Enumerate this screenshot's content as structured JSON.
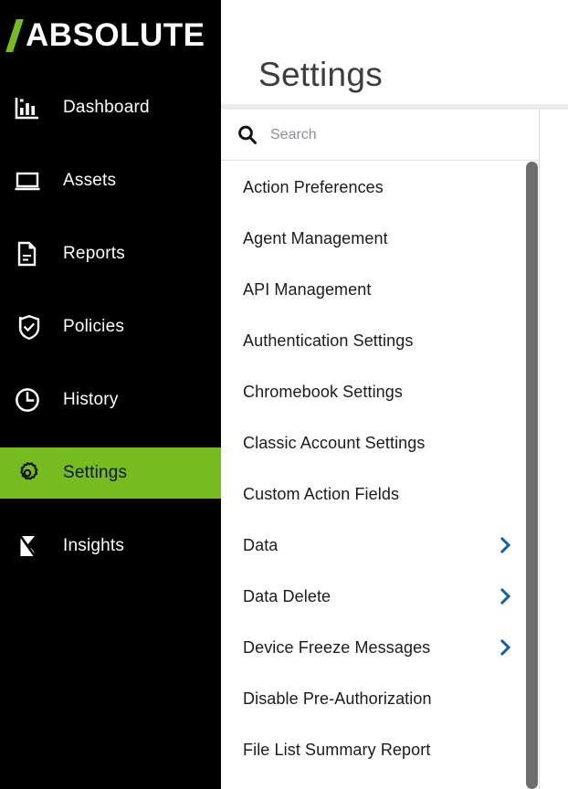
{
  "brand": {
    "name": "ABSOLUTE",
    "accent_color": "#76bc21",
    "logo_icon": "slash-mark"
  },
  "sidebar": {
    "background_color": "#000000",
    "active_color": "#76bc21",
    "items": [
      {
        "label": "Dashboard",
        "icon": "bar-chart-icon",
        "active": false
      },
      {
        "label": "Assets",
        "icon": "laptop-icon",
        "active": false
      },
      {
        "label": "Reports",
        "icon": "document-icon",
        "active": false
      },
      {
        "label": "Policies",
        "icon": "shield-check-icon",
        "active": false
      },
      {
        "label": "History",
        "icon": "clock-icon",
        "active": false
      },
      {
        "label": "Settings",
        "icon": "gear-icon",
        "active": true
      },
      {
        "label": "Insights",
        "icon": "insights-k-icon",
        "active": false
      }
    ]
  },
  "header": {
    "title": "Settings"
  },
  "search": {
    "icon": "search-icon",
    "placeholder": "Search",
    "value": ""
  },
  "menu": {
    "chevron_color": "#1560a8",
    "items": [
      {
        "label": "Action Preferences",
        "has_chevron": false
      },
      {
        "label": "Agent Management",
        "has_chevron": false
      },
      {
        "label": "API Management",
        "has_chevron": false
      },
      {
        "label": "Authentication Settings",
        "has_chevron": false
      },
      {
        "label": "Chromebook Settings",
        "has_chevron": false
      },
      {
        "label": "Classic Account Settings",
        "has_chevron": false
      },
      {
        "label": "Custom Action Fields",
        "has_chevron": false
      },
      {
        "label": "Data",
        "has_chevron": true
      },
      {
        "label": "Data Delete",
        "has_chevron": true
      },
      {
        "label": "Device Freeze Messages",
        "has_chevron": true
      },
      {
        "label": "Disable Pre-Authorization",
        "has_chevron": false
      },
      {
        "label": "File List Summary Report",
        "has_chevron": false
      }
    ]
  },
  "scrollbar": {
    "thumb_color": "#6e6e6e"
  }
}
